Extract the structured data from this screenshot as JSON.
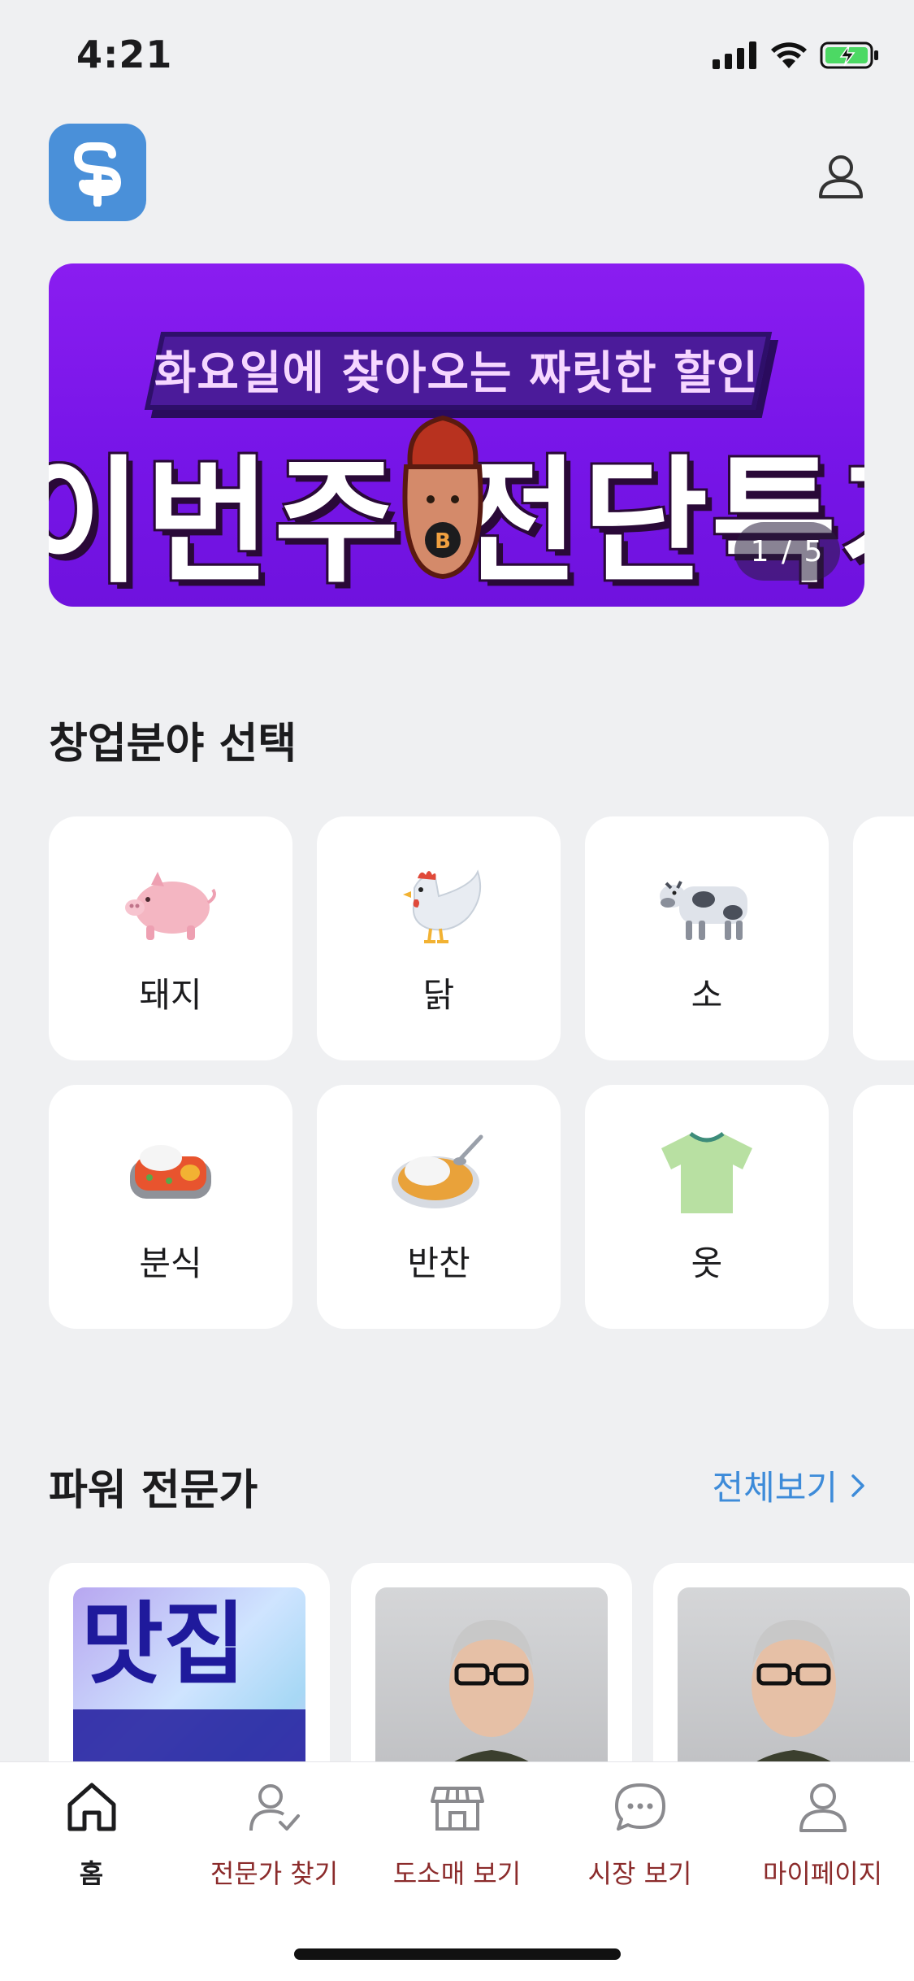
{
  "status": {
    "time": "4:21"
  },
  "banner": {
    "subtitle": "화요일에 찾아오는 짜릿한 할인",
    "title": "이번주 전단특가",
    "pager": "1 / 5"
  },
  "categories": {
    "title": "창업분야 선택",
    "items": [
      {
        "label": "돼지",
        "icon": "pig-icon"
      },
      {
        "label": "닭",
        "icon": "chicken-icon"
      },
      {
        "label": "소",
        "icon": "cow-icon"
      },
      {
        "label": "분식",
        "icon": "snack-food-icon"
      },
      {
        "label": "반찬",
        "icon": "side-dish-icon"
      },
      {
        "label": "옷",
        "icon": "tshirt-icon"
      }
    ]
  },
  "experts": {
    "title": "파워 전문가",
    "see_all": "전체보기",
    "card1_art_text": "맛집"
  },
  "tabs": [
    {
      "label": "홈",
      "icon": "home-icon",
      "active": true
    },
    {
      "label": "전문가 찾기",
      "icon": "expert-search-icon"
    },
    {
      "label": "도소매 보기",
      "icon": "store-icon"
    },
    {
      "label": "시장 보기",
      "icon": "chat-bubble-icon"
    },
    {
      "label": "마이페이지",
      "icon": "person-icon"
    }
  ],
  "colors": {
    "accent": "#3d8bd9",
    "logo": "#4a90d9",
    "banner": "#7a17ea",
    "tab_inactive_label": "#8b2b2b"
  }
}
